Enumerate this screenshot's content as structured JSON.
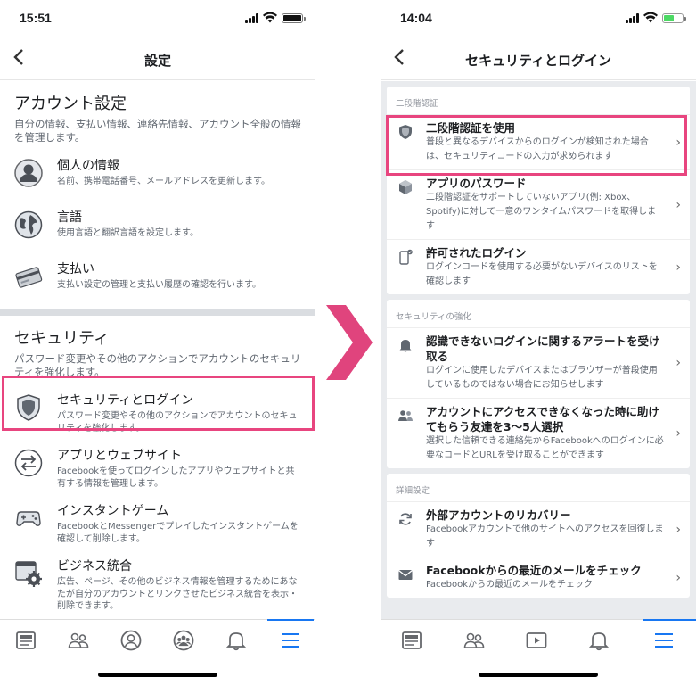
{
  "left": {
    "time": "15:51",
    "nav_title": "設定",
    "sections": [
      {
        "title": "アカウント設定",
        "desc": "自分の情報、支払い情報、連絡先情報、アカウント全般の情報を管理します。",
        "items": [
          {
            "title": "個人の情報",
            "desc": "名前、携帯電話番号、メールアドレスを更新します。",
            "icon": "person-icon"
          },
          {
            "title": "言語",
            "desc": "使用言語と翻訳言語を設定します。",
            "icon": "globe-icon"
          },
          {
            "title": "支払い",
            "desc": "支払い設定の管理と支払い履歴の確認を行います。",
            "icon": "credit-card-icon"
          }
        ]
      },
      {
        "title": "セキュリティ",
        "desc": "パスワード変更やその他のアクションでアカウントのセキュリティを強化します。",
        "items": [
          {
            "title": "セキュリティとログイン",
            "desc": "パスワード変更やその他のアクションでアカウントのセキュリティを強化します。",
            "icon": "shield-icon"
          },
          {
            "title": "アプリとウェブサイト",
            "desc": "Facebookを使ってログインしたアプリやウェブサイトと共有する情報を管理します。",
            "icon": "swap-arrows-icon"
          },
          {
            "title": "インスタントゲーム",
            "desc": "FacebookとMessengerでプレイしたインスタントゲームを確認して削除します。",
            "icon": "gamepad-icon"
          },
          {
            "title": "ビジネス統合",
            "desc": "広告、ページ、その他のビジネス情報を管理するためにあなたが自分のアカウントとリンクさせたビジネス統合を表示・削除できます。",
            "icon": "business-gear-icon"
          }
        ]
      }
    ]
  },
  "right": {
    "time": "14:04",
    "nav_title": "セキュリティとログイン",
    "cards": [
      {
        "head": "二段階認証",
        "items": [
          {
            "title": "二段階認証を使用",
            "desc": "普段と異なるデバイスからのログインが検知された場合は、セキュリティコードの入力が求められます",
            "icon": "shield-icon"
          },
          {
            "title": "アプリのパスワード",
            "desc": "二段階認証をサポートしていないアプリ(例: Xbox、Spotify)に対して一意のワンタイムパスワードを取得します",
            "icon": "cube-icon"
          },
          {
            "title": "許可されたログイン",
            "desc": "ログインコードを使用する必要がないデバイスのリストを確認します",
            "icon": "phone-icon"
          }
        ]
      },
      {
        "head": "セキュリティの強化",
        "items": [
          {
            "title": "認識できないログインに関するアラートを受け取る",
            "desc": "ログインに使用したデバイスまたはブラウザーが普段使用しているものではない場合にお知らせします",
            "icon": "bell-icon"
          },
          {
            "title": "アカウントにアクセスできなくなった時に助けてもらう友達を3〜5人選択",
            "desc": "選択した信頼できる連絡先からFacebookへのログインに必要なコードとURLを受け取ることができます",
            "icon": "friends-icon"
          }
        ]
      },
      {
        "head": "詳細設定",
        "items": [
          {
            "title": "外部アカウントのリカバリー",
            "desc": "Facebookアカウントで他のサイトへのアクセスを回復します",
            "icon": "refresh-icon"
          },
          {
            "title": "Facebookからの最近のメールをチェック",
            "desc": "Facebookからの最近のメールをチェック",
            "icon": "envelope-icon"
          }
        ]
      }
    ]
  },
  "colors": {
    "highlight": "#e8457f",
    "accent": "#1877f2"
  }
}
